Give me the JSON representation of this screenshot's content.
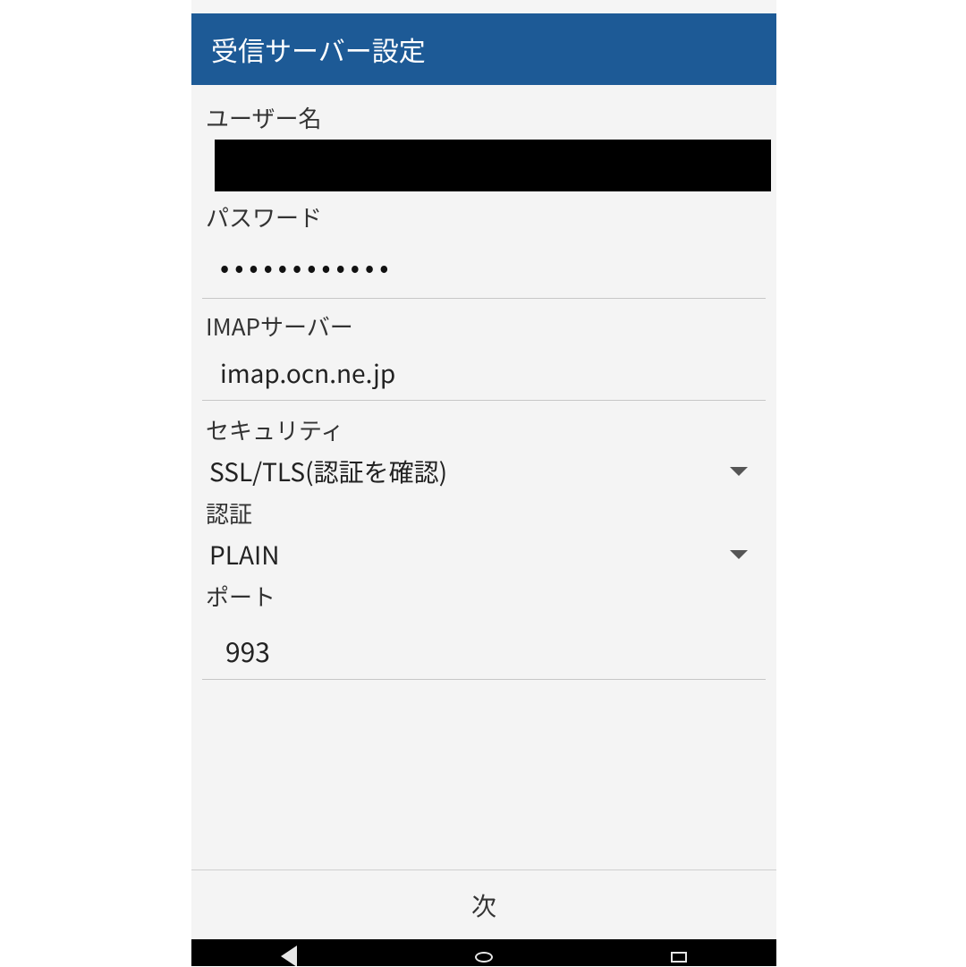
{
  "header": {
    "title": "受信サーバー設定"
  },
  "fields": {
    "username_label": "ユーザー名",
    "username_value": "",
    "password_label": "パスワード",
    "password_value": "••••••••••••",
    "imap_label": "IMAPサーバー",
    "imap_value": "imap.ocn.ne.jp",
    "security_label": "セキュリティ",
    "security_value": "SSL/TLS(認証を確認)",
    "auth_label": "認証",
    "auth_value": "PLAIN",
    "port_label": "ポート",
    "port_value": "993"
  },
  "footer": {
    "next_label": "次"
  }
}
